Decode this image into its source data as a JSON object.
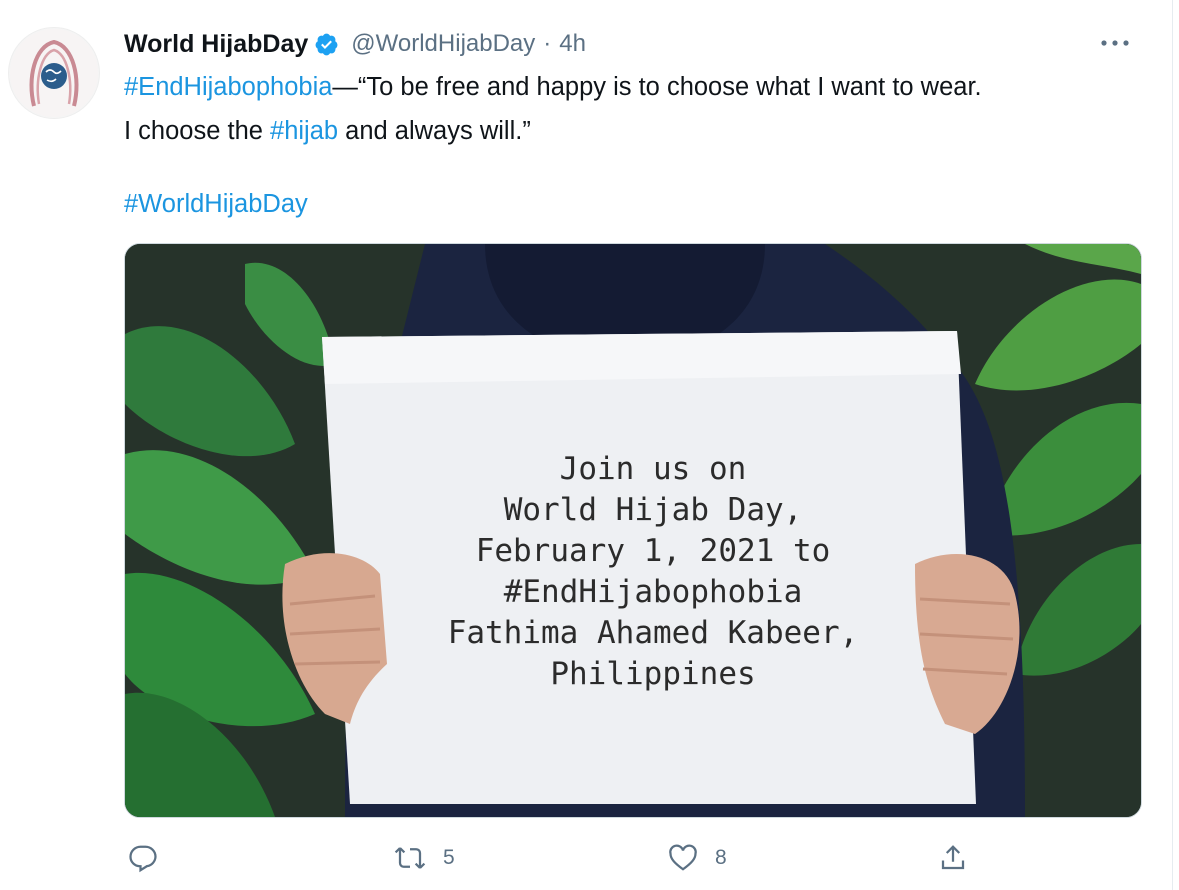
{
  "account": {
    "name": "World HijabDay",
    "handle": "@WorldHijabDay",
    "separator": "·",
    "time": "4h"
  },
  "tweet": {
    "line1": {
      "tag": "#EndHijabophobia",
      "text": "—“To be free and happy is to choose what I want to wear."
    },
    "line2": {
      "before": "I choose the ",
      "tag": "#hijab",
      "after": " and always will.”"
    },
    "line3": {
      "tag": "#WorldHijabDay"
    }
  },
  "media": {
    "sign_lines": [
      "Join us on",
      "World Hijab Day,",
      "February 1, 2021 to",
      "#EndHijabophobia",
      "Fathima Ahamed Kabeer,",
      "Philippines"
    ]
  },
  "actions": {
    "reply": {
      "icon": "reply-icon",
      "count": ""
    },
    "retweet": {
      "icon": "retweet-icon",
      "count": "5"
    },
    "like": {
      "icon": "heart-icon",
      "count": "8"
    },
    "share": {
      "icon": "share-icon",
      "count": ""
    }
  },
  "colors": {
    "link": "#1b95e0",
    "secondary": "#5b7083",
    "verified": "#1da1f2"
  }
}
